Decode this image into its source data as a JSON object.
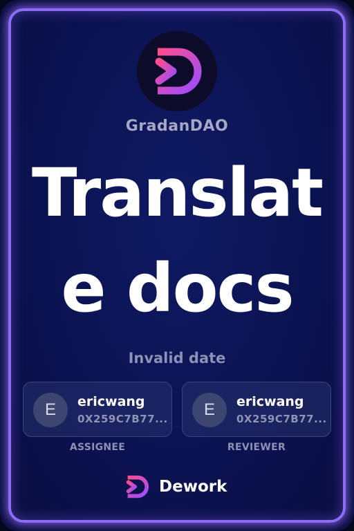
{
  "dao": {
    "name": "GradanDAO",
    "logo_icon": "gradandao-logo-icon"
  },
  "task": {
    "title": "Translate docs",
    "date": "Invalid date"
  },
  "assignee": {
    "avatar_letter": "E",
    "name": "ericwang",
    "address": "0X259C7B77...",
    "role_label": "ASSIGNEE"
  },
  "reviewer": {
    "avatar_letter": "E",
    "name": "ericwang",
    "address": "0X259C7B77...",
    "role_label": "REVIEWER"
  },
  "footer": {
    "brand": "Dework",
    "logo_icon": "dework-logo-icon"
  },
  "colors": {
    "card_border": "#8b6cf3",
    "background": "#0b1250",
    "logo_gradient_start": "#ff4d8d",
    "logo_gradient_end": "#9a4dff"
  }
}
